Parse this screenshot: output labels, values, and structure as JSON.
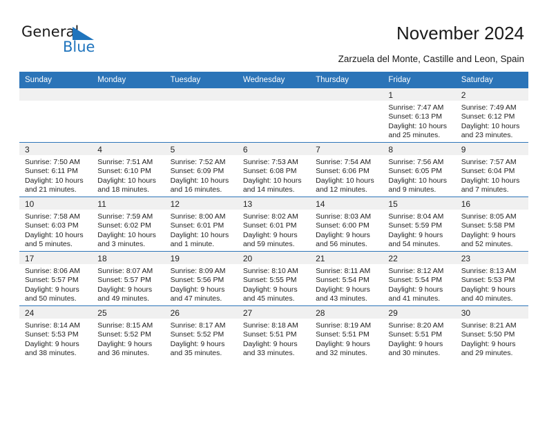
{
  "brand": {
    "name_part1": "General",
    "name_part2": "Blue",
    "triangle_color": "#1f74bd"
  },
  "header": {
    "title": "November 2024",
    "subtitle": "Zarzuela del Monte, Castille and Leon, Spain"
  },
  "theme": {
    "header_blue": "#2b74b8",
    "daynum_band": "#f0f0f0",
    "text": "#222222"
  },
  "calendar": {
    "weekday_headers": [
      "Sunday",
      "Monday",
      "Tuesday",
      "Wednesday",
      "Thursday",
      "Friday",
      "Saturday"
    ],
    "weeks": [
      [
        {
          "day": ""
        },
        {
          "day": ""
        },
        {
          "day": ""
        },
        {
          "day": ""
        },
        {
          "day": ""
        },
        {
          "day": "1",
          "sunrise": "Sunrise: 7:47 AM",
          "sunset": "Sunset: 6:13 PM",
          "daylight1": "Daylight: 10 hours",
          "daylight2": "and 25 minutes."
        },
        {
          "day": "2",
          "sunrise": "Sunrise: 7:49 AM",
          "sunset": "Sunset: 6:12 PM",
          "daylight1": "Daylight: 10 hours",
          "daylight2": "and 23 minutes."
        }
      ],
      [
        {
          "day": "3",
          "sunrise": "Sunrise: 7:50 AM",
          "sunset": "Sunset: 6:11 PM",
          "daylight1": "Daylight: 10 hours",
          "daylight2": "and 21 minutes."
        },
        {
          "day": "4",
          "sunrise": "Sunrise: 7:51 AM",
          "sunset": "Sunset: 6:10 PM",
          "daylight1": "Daylight: 10 hours",
          "daylight2": "and 18 minutes."
        },
        {
          "day": "5",
          "sunrise": "Sunrise: 7:52 AM",
          "sunset": "Sunset: 6:09 PM",
          "daylight1": "Daylight: 10 hours",
          "daylight2": "and 16 minutes."
        },
        {
          "day": "6",
          "sunrise": "Sunrise: 7:53 AM",
          "sunset": "Sunset: 6:08 PM",
          "daylight1": "Daylight: 10 hours",
          "daylight2": "and 14 minutes."
        },
        {
          "day": "7",
          "sunrise": "Sunrise: 7:54 AM",
          "sunset": "Sunset: 6:06 PM",
          "daylight1": "Daylight: 10 hours",
          "daylight2": "and 12 minutes."
        },
        {
          "day": "8",
          "sunrise": "Sunrise: 7:56 AM",
          "sunset": "Sunset: 6:05 PM",
          "daylight1": "Daylight: 10 hours",
          "daylight2": "and 9 minutes."
        },
        {
          "day": "9",
          "sunrise": "Sunrise: 7:57 AM",
          "sunset": "Sunset: 6:04 PM",
          "daylight1": "Daylight: 10 hours",
          "daylight2": "and 7 minutes."
        }
      ],
      [
        {
          "day": "10",
          "sunrise": "Sunrise: 7:58 AM",
          "sunset": "Sunset: 6:03 PM",
          "daylight1": "Daylight: 10 hours",
          "daylight2": "and 5 minutes."
        },
        {
          "day": "11",
          "sunrise": "Sunrise: 7:59 AM",
          "sunset": "Sunset: 6:02 PM",
          "daylight1": "Daylight: 10 hours",
          "daylight2": "and 3 minutes."
        },
        {
          "day": "12",
          "sunrise": "Sunrise: 8:00 AM",
          "sunset": "Sunset: 6:01 PM",
          "daylight1": "Daylight: 10 hours",
          "daylight2": "and 1 minute."
        },
        {
          "day": "13",
          "sunrise": "Sunrise: 8:02 AM",
          "sunset": "Sunset: 6:01 PM",
          "daylight1": "Daylight: 9 hours",
          "daylight2": "and 59 minutes."
        },
        {
          "day": "14",
          "sunrise": "Sunrise: 8:03 AM",
          "sunset": "Sunset: 6:00 PM",
          "daylight1": "Daylight: 9 hours",
          "daylight2": "and 56 minutes."
        },
        {
          "day": "15",
          "sunrise": "Sunrise: 8:04 AM",
          "sunset": "Sunset: 5:59 PM",
          "daylight1": "Daylight: 9 hours",
          "daylight2": "and 54 minutes."
        },
        {
          "day": "16",
          "sunrise": "Sunrise: 8:05 AM",
          "sunset": "Sunset: 5:58 PM",
          "daylight1": "Daylight: 9 hours",
          "daylight2": "and 52 minutes."
        }
      ],
      [
        {
          "day": "17",
          "sunrise": "Sunrise: 8:06 AM",
          "sunset": "Sunset: 5:57 PM",
          "daylight1": "Daylight: 9 hours",
          "daylight2": "and 50 minutes."
        },
        {
          "day": "18",
          "sunrise": "Sunrise: 8:07 AM",
          "sunset": "Sunset: 5:57 PM",
          "daylight1": "Daylight: 9 hours",
          "daylight2": "and 49 minutes."
        },
        {
          "day": "19",
          "sunrise": "Sunrise: 8:09 AM",
          "sunset": "Sunset: 5:56 PM",
          "daylight1": "Daylight: 9 hours",
          "daylight2": "and 47 minutes."
        },
        {
          "day": "20",
          "sunrise": "Sunrise: 8:10 AM",
          "sunset": "Sunset: 5:55 PM",
          "daylight1": "Daylight: 9 hours",
          "daylight2": "and 45 minutes."
        },
        {
          "day": "21",
          "sunrise": "Sunrise: 8:11 AM",
          "sunset": "Sunset: 5:54 PM",
          "daylight1": "Daylight: 9 hours",
          "daylight2": "and 43 minutes."
        },
        {
          "day": "22",
          "sunrise": "Sunrise: 8:12 AM",
          "sunset": "Sunset: 5:54 PM",
          "daylight1": "Daylight: 9 hours",
          "daylight2": "and 41 minutes."
        },
        {
          "day": "23",
          "sunrise": "Sunrise: 8:13 AM",
          "sunset": "Sunset: 5:53 PM",
          "daylight1": "Daylight: 9 hours",
          "daylight2": "and 40 minutes."
        }
      ],
      [
        {
          "day": "24",
          "sunrise": "Sunrise: 8:14 AM",
          "sunset": "Sunset: 5:53 PM",
          "daylight1": "Daylight: 9 hours",
          "daylight2": "and 38 minutes."
        },
        {
          "day": "25",
          "sunrise": "Sunrise: 8:15 AM",
          "sunset": "Sunset: 5:52 PM",
          "daylight1": "Daylight: 9 hours",
          "daylight2": "and 36 minutes."
        },
        {
          "day": "26",
          "sunrise": "Sunrise: 8:17 AM",
          "sunset": "Sunset: 5:52 PM",
          "daylight1": "Daylight: 9 hours",
          "daylight2": "and 35 minutes."
        },
        {
          "day": "27",
          "sunrise": "Sunrise: 8:18 AM",
          "sunset": "Sunset: 5:51 PM",
          "daylight1": "Daylight: 9 hours",
          "daylight2": "and 33 minutes."
        },
        {
          "day": "28",
          "sunrise": "Sunrise: 8:19 AM",
          "sunset": "Sunset: 5:51 PM",
          "daylight1": "Daylight: 9 hours",
          "daylight2": "and 32 minutes."
        },
        {
          "day": "29",
          "sunrise": "Sunrise: 8:20 AM",
          "sunset": "Sunset: 5:51 PM",
          "daylight1": "Daylight: 9 hours",
          "daylight2": "and 30 minutes."
        },
        {
          "day": "30",
          "sunrise": "Sunrise: 8:21 AM",
          "sunset": "Sunset: 5:50 PM",
          "daylight1": "Daylight: 9 hours",
          "daylight2": "and 29 minutes."
        }
      ]
    ]
  }
}
